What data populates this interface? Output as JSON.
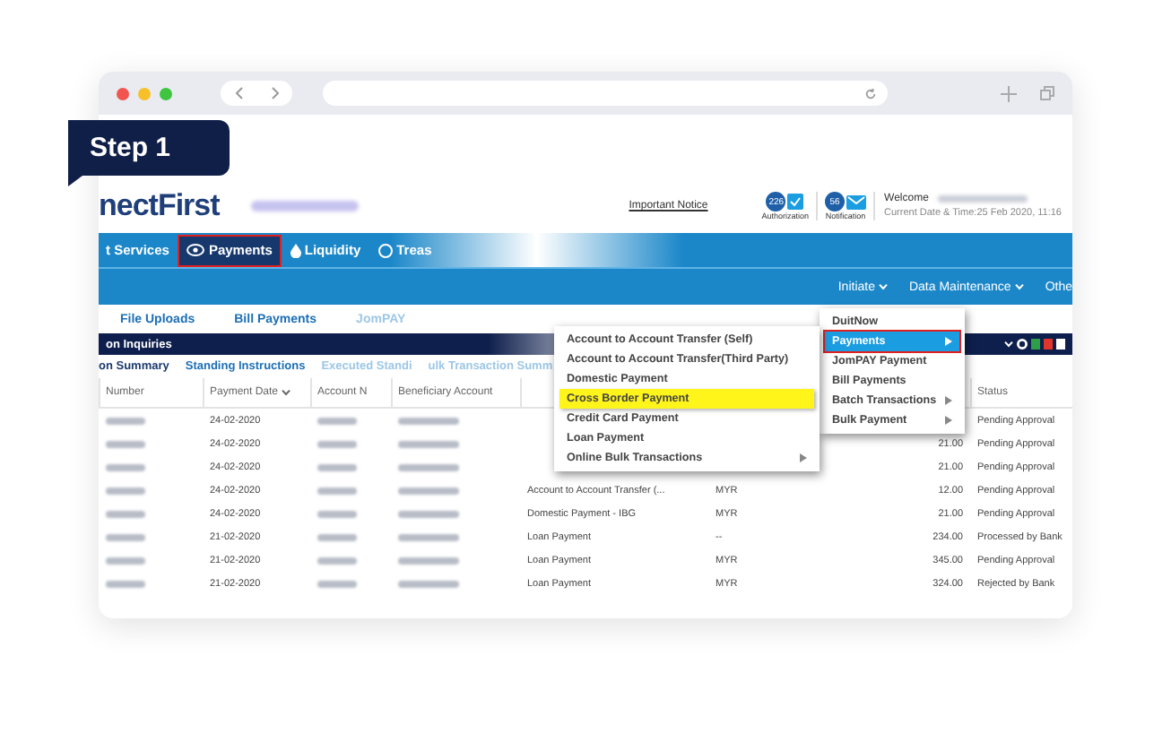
{
  "step_badge": "Step 1",
  "header": {
    "logo": "nectFirst",
    "important_notice": "Important Notice",
    "authorization": {
      "count": "226",
      "label": "Authorization"
    },
    "notification": {
      "count": "56",
      "label": "Notification"
    },
    "welcome": "Welcome",
    "datetime": "Current Date & Time:25 Feb 2020, 11:16"
  },
  "nav": [
    {
      "label": "t Services",
      "selected": false
    },
    {
      "label": "Payments",
      "selected": true
    },
    {
      "label": "Liquidity",
      "selected": false
    },
    {
      "label": "Treas",
      "selected": false
    }
  ],
  "subnav": [
    {
      "label": "Initiate",
      "caret": true
    },
    {
      "label": "Data Maintenance",
      "caret": true
    },
    {
      "label": "Othe",
      "caret": false
    }
  ],
  "module_tabs": [
    {
      "label": "File Uploads",
      "dimmed": false
    },
    {
      "label": "Bill Payments",
      "dimmed": false
    },
    {
      "label": "JomPAY",
      "dimmed": true
    }
  ],
  "section_title": "on Inquiries",
  "inquiry_tabs": [
    {
      "label": "on Summary",
      "dimmed": false
    },
    {
      "label": "Standing Instructions",
      "dimmed": false
    },
    {
      "label": "Executed Standi",
      "dimmed": true
    },
    {
      "label": "ulk Transaction Summ",
      "dimmed": true
    }
  ],
  "table": {
    "columns": [
      {
        "label": "Number",
        "sorted": false
      },
      {
        "label": "Payment Date",
        "sorted": true
      },
      {
        "label": "Account N",
        "sorted": false
      },
      {
        "label": "Beneficiary Account",
        "sorted": false
      },
      {
        "label": "Status",
        "sorted": false
      }
    ],
    "rows": [
      {
        "payment_date": "24-02-2020",
        "status": "Pending Approval"
      },
      {
        "payment_date": "24-02-2020",
        "amount": "21.00",
        "status": "Pending Approval"
      },
      {
        "payment_date": "24-02-2020",
        "amount": "21.00",
        "status": "Pending Approval"
      },
      {
        "payment_date": "24-02-2020",
        "type": "Account to Account Transfer (...",
        "currency": "MYR",
        "amount": "12.00",
        "status": "Pending Approval"
      },
      {
        "payment_date": "24-02-2020",
        "type": "Domestic Payment - IBG",
        "currency": "MYR",
        "amount": "21.00",
        "status": "Pending Approval"
      },
      {
        "payment_date": "21-02-2020",
        "type": "Loan Payment",
        "currency": "--",
        "amount": "234.00",
        "status": "Processed by Bank"
      },
      {
        "payment_date": "21-02-2020",
        "type": "Loan Payment",
        "currency": "MYR",
        "amount": "345.00",
        "status": "Pending Approval"
      },
      {
        "payment_date": "21-02-2020",
        "type": "Loan Payment",
        "currency": "MYR",
        "amount": "324.00",
        "status": "Rejected by Bank"
      }
    ]
  },
  "initiate_menu": [
    {
      "label": "DuitNow",
      "submenu": false,
      "selected": false
    },
    {
      "label": "Payments",
      "submenu": true,
      "selected": true
    },
    {
      "label": "JomPAY Payment",
      "submenu": false,
      "selected": false
    },
    {
      "label": "Bill Payments",
      "submenu": false,
      "selected": false
    },
    {
      "label": "Batch Transactions",
      "submenu": true,
      "selected": false
    },
    {
      "label": "Bulk Payment",
      "submenu": true,
      "selected": false
    }
  ],
  "payments_submenu": [
    {
      "label": "Account to Account Transfer (Self)",
      "submenu": false,
      "highlighted": false
    },
    {
      "label": "Account to Account Transfer(Third Party)",
      "submenu": false,
      "highlighted": false
    },
    {
      "label": "Domestic Payment",
      "submenu": false,
      "highlighted": false
    },
    {
      "label": "Cross Border Payment",
      "submenu": false,
      "highlighted": true
    },
    {
      "label": "Credit Card Payment",
      "submenu": false,
      "highlighted": false
    },
    {
      "label": "Loan Payment",
      "submenu": false,
      "highlighted": false
    },
    {
      "label": "Online Bulk Transactions",
      "submenu": true,
      "highlighted": false
    }
  ]
}
